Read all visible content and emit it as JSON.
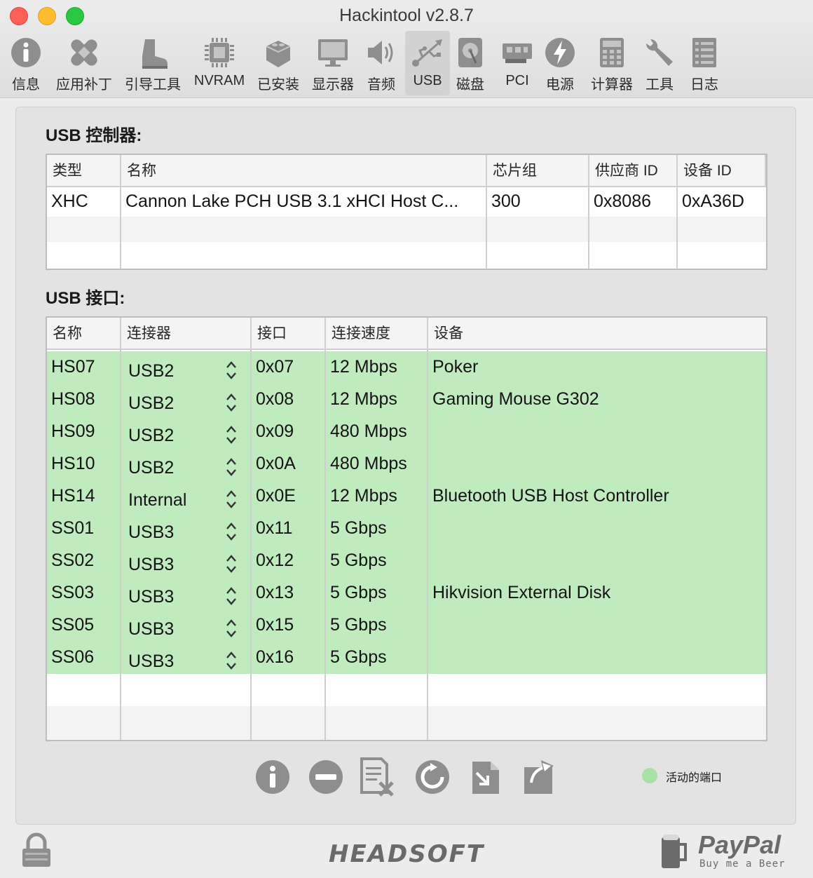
{
  "window": {
    "title": "Hackintool v2.8.7"
  },
  "toolbar": [
    {
      "label": "信息",
      "icon": "info-icon"
    },
    {
      "label": "应用补丁",
      "icon": "bandage-icon"
    },
    {
      "label": "引导工具",
      "icon": "boot-icon"
    },
    {
      "label": "NVRAM",
      "icon": "chip-icon"
    },
    {
      "label": "已安装",
      "icon": "lego-icon"
    },
    {
      "label": "显示器",
      "icon": "monitor-icon"
    },
    {
      "label": "音频",
      "icon": "speaker-icon"
    },
    {
      "label": "USB",
      "icon": "usb-icon",
      "active": true
    },
    {
      "label": "磁盘",
      "icon": "disk-icon"
    },
    {
      "label": "PCI",
      "icon": "pci-card-icon"
    },
    {
      "label": "电源",
      "icon": "power-bolt-icon"
    },
    {
      "label": "计算器",
      "icon": "calculator-icon"
    },
    {
      "label": "工具",
      "icon": "wrench-icon"
    },
    {
      "label": "日志",
      "icon": "log-list-icon"
    }
  ],
  "controllers": {
    "title": "USB 控制器:",
    "columns": [
      "类型",
      "名称",
      "芯片组",
      "供应商 ID",
      "设备 ID"
    ],
    "rows": [
      [
        "XHC",
        "Cannon Lake PCH USB 3.1 xHCI Host C...",
        "300",
        "0x8086",
        "0xA36D"
      ]
    ]
  },
  "ports": {
    "title": "USB 接口:",
    "columns": [
      "名称",
      "连接器",
      "接口",
      "连接速度",
      "设备"
    ],
    "rows": [
      [
        "HS07",
        "USB2",
        "0x07",
        "12 Mbps",
        "Poker"
      ],
      [
        "HS08",
        "USB2",
        "0x08",
        "12 Mbps",
        "Gaming Mouse G302"
      ],
      [
        "HS09",
        "USB2",
        "0x09",
        "480 Mbps",
        ""
      ],
      [
        "HS10",
        "USB2",
        "0x0A",
        "480 Mbps",
        ""
      ],
      [
        "HS14",
        "Internal",
        "0x0E",
        "12 Mbps",
        "Bluetooth USB Host Controller"
      ],
      [
        "SS01",
        "USB3",
        "0x11",
        "5 Gbps",
        ""
      ],
      [
        "SS02",
        "USB3",
        "0x12",
        "5 Gbps",
        ""
      ],
      [
        "SS03",
        "USB3",
        "0x13",
        "5 Gbps",
        "Hikvision External Disk"
      ],
      [
        "SS05",
        "USB3",
        "0x15",
        "5 Gbps",
        ""
      ],
      [
        "SS06",
        "USB3",
        "0x16",
        "5 Gbps",
        ""
      ]
    ]
  },
  "legend": {
    "label": "活动的端口",
    "color": "#a8e0a8"
  },
  "footer": {
    "brand": "HEADSOFT",
    "paypal": "PayPal",
    "paypal_sub": "Buy me a Beer"
  },
  "colors": {
    "active_row": "#bfebbf",
    "icon_gray": "#8e8e8e"
  }
}
